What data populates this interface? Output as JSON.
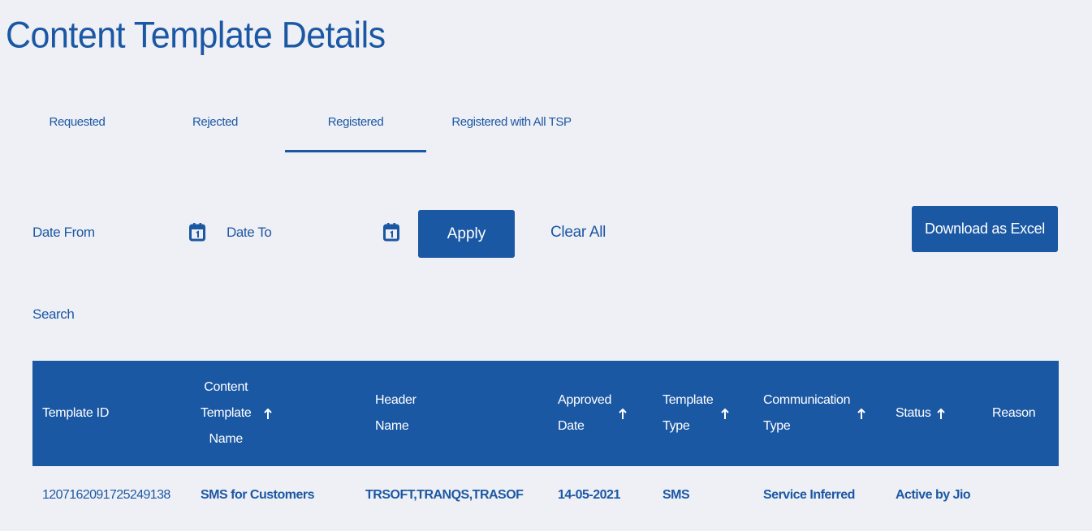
{
  "page": {
    "title": "Content Template Details"
  },
  "tabs": [
    {
      "label": "Requested",
      "active": false
    },
    {
      "label": "Rejected",
      "active": false
    },
    {
      "label": "Registered",
      "active": true
    },
    {
      "label": "Registered with All TSP",
      "active": false
    }
  ],
  "filters": {
    "date_from_label": "Date From",
    "date_to_label": "Date To",
    "calendar_icon": "calendar-icon",
    "apply_label": "Apply",
    "clear_all_label": "Clear All",
    "download_label": "Download as Excel"
  },
  "search": {
    "label": "Search"
  },
  "table": {
    "columns": [
      {
        "label": "Template ID",
        "sortable": false
      },
      {
        "label": "Content Template Name",
        "lines": [
          "Content",
          "Template",
          "Name"
        ],
        "sortable": true
      },
      {
        "label": "Header Name",
        "lines": [
          "Header",
          "Name"
        ],
        "sortable": false
      },
      {
        "label": "Approved Date",
        "lines": [
          "Approved",
          "Date"
        ],
        "sortable": true
      },
      {
        "label": "Template Type",
        "lines": [
          "Template",
          "Type"
        ],
        "sortable": true
      },
      {
        "label": "Communication Type",
        "lines": [
          "Communication",
          "Type"
        ],
        "sortable": true
      },
      {
        "label": "Status",
        "sortable": true
      },
      {
        "label": "Reason",
        "sortable": false
      }
    ],
    "sort_icon": "arrow-up-icon",
    "rows": [
      {
        "template_id": "1207162091725249138",
        "content_template_name": "SMS for Customers",
        "header_name": "TRSOFT,TRANQS,TRASOF",
        "approved_date": "14-05-2021",
        "template_type": "SMS",
        "communication_type": "Service Inferred",
        "status": "Active by Jio",
        "reason": ""
      }
    ]
  },
  "colors": {
    "primary": "#1b58a4",
    "background": "#eff0f5",
    "on_primary": "#ffffff"
  }
}
